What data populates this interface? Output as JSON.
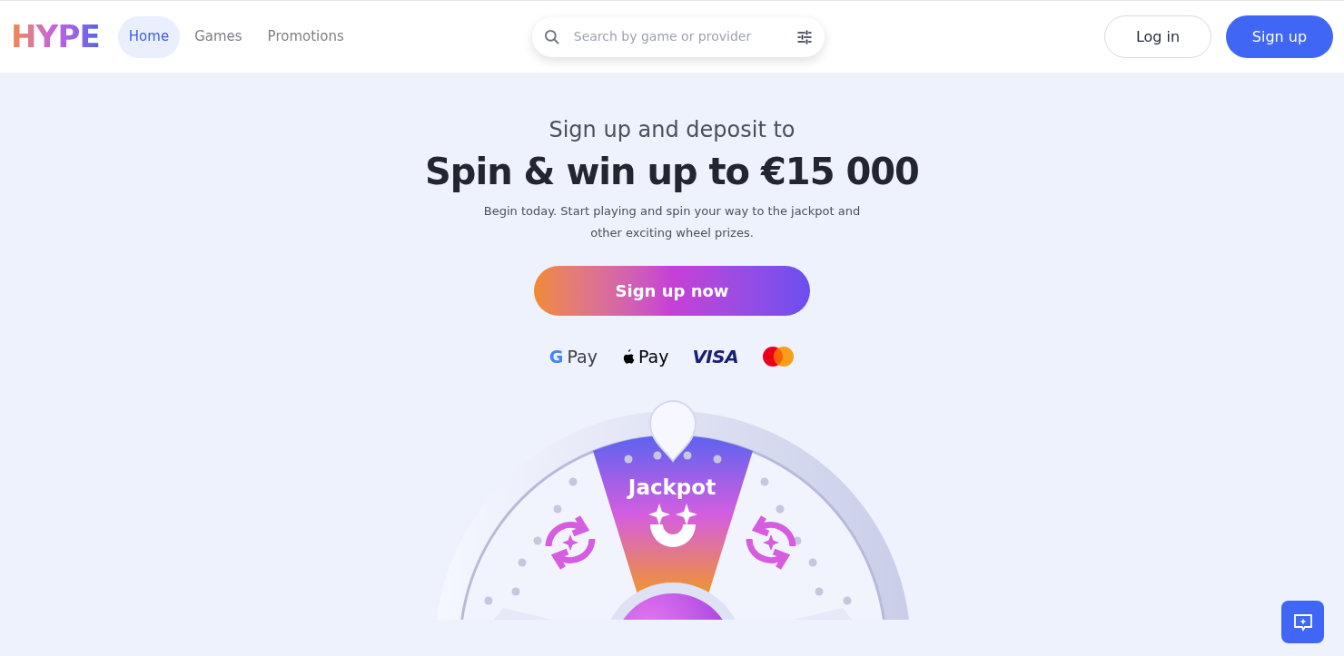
{
  "header": {
    "logo": "HYPE",
    "nav": [
      {
        "label": "Home",
        "selected": true
      },
      {
        "label": "Games",
        "selected": false
      },
      {
        "label": "Promotions",
        "selected": false
      }
    ],
    "search": {
      "placeholder": "Search by game or provider"
    },
    "buttons": [
      {
        "label": "Log in",
        "kind": "outline"
      },
      {
        "label": "Sign up",
        "kind": "primary"
      }
    ]
  },
  "hero": {
    "subtitle": "Sign up and deposit to",
    "title": "Spin & win up to €15 000",
    "description": "Begin today. Start playing and spin your way to the jackpot and other exciting wheel prizes.",
    "cta": "Sign up now"
  },
  "payments": [
    {
      "kind": "google",
      "mark": "G",
      "label": "Pay"
    },
    {
      "kind": "apple",
      "label": "Pay"
    },
    {
      "kind": "visa",
      "label": "VISA"
    },
    {
      "kind": "mastercard"
    }
  ],
  "wheel": {
    "jackpot_label": "Jackpot"
  }
}
